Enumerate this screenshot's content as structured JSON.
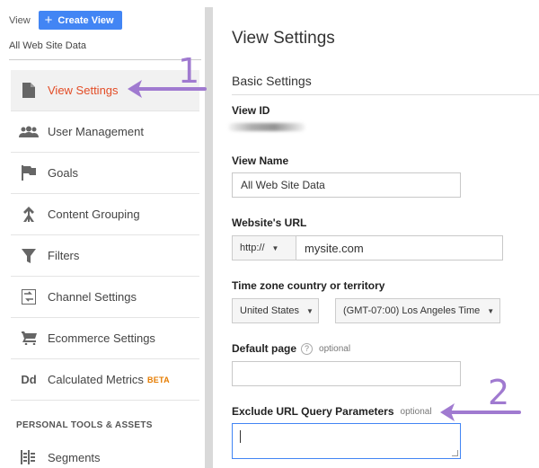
{
  "sidebar": {
    "view_label": "View",
    "create_view_label": "Create View",
    "account_name": "All Web Site Data",
    "items": [
      {
        "label": "View Settings",
        "icon": "document-icon",
        "active": true
      },
      {
        "label": "User Management",
        "icon": "users-icon"
      },
      {
        "label": "Goals",
        "icon": "flag-icon"
      },
      {
        "label": "Content Grouping",
        "icon": "content-grouping-icon"
      },
      {
        "label": "Filters",
        "icon": "funnel-icon"
      },
      {
        "label": "Channel Settings",
        "icon": "channel-settings-icon"
      },
      {
        "label": "Ecommerce Settings",
        "icon": "cart-icon"
      },
      {
        "label": "Calculated Metrics",
        "icon": "dd-icon",
        "icon_text": "Dd",
        "badge": "BETA"
      }
    ],
    "section_heading": "PERSONAL TOOLS & ASSETS",
    "tools": [
      {
        "label": "Segments",
        "icon": "segments-icon"
      }
    ]
  },
  "main": {
    "title": "View Settings",
    "section": "Basic Settings",
    "view_id": {
      "label": "View ID"
    },
    "view_name": {
      "label": "View Name",
      "value": "All Web Site Data"
    },
    "website_url": {
      "label": "Website's URL",
      "protocol": "http://",
      "value": "mysite.com"
    },
    "timezone": {
      "label": "Time zone country or territory",
      "country": "United States",
      "zone": "(GMT-07:00) Los Angeles Time"
    },
    "default_page": {
      "label": "Default page",
      "help": "?",
      "optional": "optional",
      "value": ""
    },
    "exclude_params": {
      "label": "Exclude URL Query Parameters",
      "optional": "optional",
      "value": ""
    }
  },
  "annotations": {
    "one": "1",
    "two": "2",
    "color": "#a07ad0"
  },
  "colors": {
    "accent": "#4285f4",
    "active_nav": "#e34c26",
    "beta": "#e67c00"
  }
}
